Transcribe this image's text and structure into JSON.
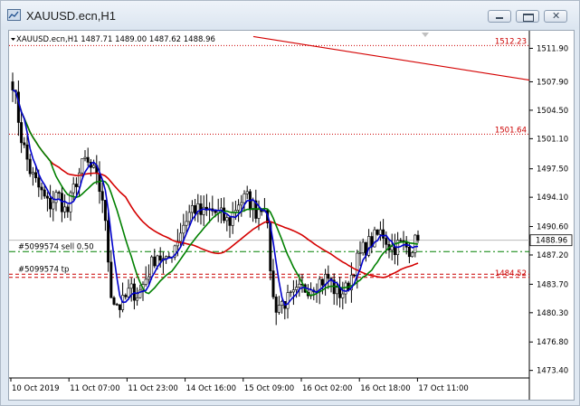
{
  "window": {
    "title": "XAUUSD.ecn,H1",
    "buttons": [
      "minimize",
      "restore",
      "close"
    ]
  },
  "chart_header": {
    "text": "XAUUSD.ecn,H1  1487.71 1489.00 1487.62 1488.96"
  },
  "price_axis": {
    "ticks": [
      "1511.90",
      "1507.90",
      "1504.50",
      "1501.10",
      "1497.50",
      "1494.10",
      "1490.60",
      "1487.20",
      "1483.70",
      "1480.30",
      "1476.80",
      "1473.40"
    ],
    "current_price": "1488.96"
  },
  "time_axis": {
    "labels": [
      "10 Oct 2019",
      "11 Oct 07:00",
      "11 Oct 23:00",
      "14 Oct 16:00",
      "15 Oct 09:00",
      "16 Oct 02:00",
      "16 Oct 18:00",
      "17 Oct 11:00"
    ]
  },
  "levels": [
    {
      "label": "1512.23",
      "price": 1512.23,
      "color": "#cc0000",
      "style": "dotted"
    },
    {
      "label": "1501.64",
      "price": 1501.64,
      "color": "#cc0000",
      "style": "dotted"
    },
    {
      "label": "1484.52",
      "price": 1484.52,
      "color": "#cc0000",
      "style": "dashed"
    }
  ],
  "orders": [
    {
      "text": "#5099574 sell 0.50",
      "price": 1487.6,
      "color": "#008000",
      "style": "dashdot"
    },
    {
      "text": "#5099574 tp",
      "price": 1484.9,
      "color": "#cc0000",
      "style": "dashed"
    }
  ],
  "indicators": [
    {
      "name": "MA red",
      "color": "#d40000"
    },
    {
      "name": "MA green",
      "color": "#008000"
    },
    {
      "name": "MA blue",
      "color": "#0000cc"
    }
  ],
  "trendline": {
    "color": "#d40000",
    "from_price": 1513.3,
    "to_price": 1508.1
  },
  "chart_data": {
    "type": "candlestick",
    "symbol": "XAUUSD.ecn",
    "timeframe": "H1",
    "ylim": [
      1472.5,
      1514.0
    ],
    "last_ohlc": {
      "open": 1487.71,
      "high": 1489.0,
      "low": 1487.62,
      "close": 1488.96
    },
    "close_path": [
      1508.0,
      1501.0,
      1497.0,
      1495.0,
      1493.0,
      1494.5,
      1492.0,
      1496.0,
      1498.5,
      1497.0,
      1494.0,
      1482.0,
      1481.0,
      1483.0,
      1482.5,
      1485.0,
      1487.5,
      1486.0,
      1488.5,
      1491.0,
      1493.0,
      1492.0,
      1492.5,
      1492.0,
      1491.0,
      1493.5,
      1494.0,
      1492.5,
      1493.5,
      1481.0,
      1481.5,
      1482.0,
      1483.0,
      1483.5,
      1484.0,
      1484.5,
      1482.5,
      1483.0,
      1486.0,
      1488.0,
      1489.0,
      1490.0,
      1488.0,
      1488.5,
      1488.0,
      1488.96
    ]
  }
}
